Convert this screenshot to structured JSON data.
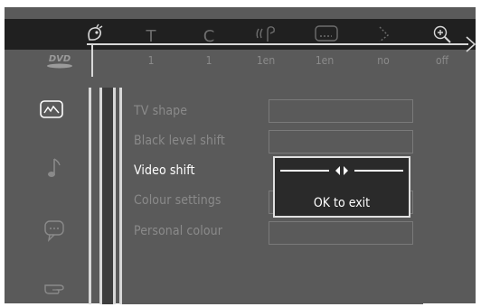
{
  "top_bar": {
    "icons": [
      {
        "name": "title-icon"
      },
      {
        "name": "title-T-icon",
        "glyph": "T"
      },
      {
        "name": "chapter-C-icon",
        "glyph": "C"
      },
      {
        "name": "audio-language-icon"
      },
      {
        "name": "subtitle-icon"
      },
      {
        "name": "angle-icon"
      },
      {
        "name": "zoom-icon"
      }
    ],
    "values": [
      "1",
      "1",
      "1en",
      "1en",
      "no",
      "off"
    ]
  },
  "disc_logo": "DVD",
  "side_icons": [
    "picture-icon",
    "music-note-icon",
    "speech-bubble-icon",
    "pointing-hand-icon"
  ],
  "menu": {
    "items": [
      {
        "label": "TV shape",
        "active": false
      },
      {
        "label": "Black level shift",
        "active": false
      },
      {
        "label": "Video shift",
        "active": true
      },
      {
        "label": "Colour settings",
        "active": false
      },
      {
        "label": "Personal colour",
        "active": false
      }
    ]
  },
  "popup": {
    "ok_label": "OK to exit"
  },
  "colors": {
    "panel_bg": "#5a5a5a",
    "iconbar_bg": "#202020",
    "inactive_text": "#8a8a8a",
    "active_text": "#ffffff"
  }
}
